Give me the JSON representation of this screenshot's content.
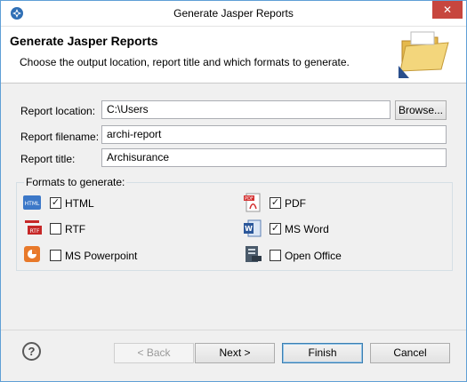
{
  "window": {
    "title": "Generate Jasper Reports",
    "close_glyph": "✕"
  },
  "banner": {
    "title": "Generate Jasper Reports",
    "description": "Choose the output location, report title and which formats to generate."
  },
  "form": {
    "report_location_label": "Report location:",
    "report_location_value": "C:\\Users",
    "browse_label": "Browse...",
    "report_filename_label": "Report filename:",
    "report_filename_value": "archi-report",
    "report_title_label": "Report title:",
    "report_title_value": "Archisurance"
  },
  "formats": {
    "group_title": "Formats to generate:",
    "items": [
      {
        "label": "HTML",
        "checked": true,
        "icon": "html-icon"
      },
      {
        "label": "PDF",
        "checked": true,
        "icon": "pdf-icon"
      },
      {
        "label": "RTF",
        "checked": false,
        "icon": "rtf-icon"
      },
      {
        "label": "MS Word",
        "checked": true,
        "icon": "ms-word-icon"
      },
      {
        "label": "MS Powerpoint",
        "checked": false,
        "icon": "ms-powerpoint-icon"
      },
      {
        "label": "Open Office",
        "checked": false,
        "icon": "open-office-icon"
      }
    ]
  },
  "buttons": {
    "back": "< Back",
    "next": "Next >",
    "finish": "Finish",
    "cancel": "Cancel",
    "help": "?"
  }
}
